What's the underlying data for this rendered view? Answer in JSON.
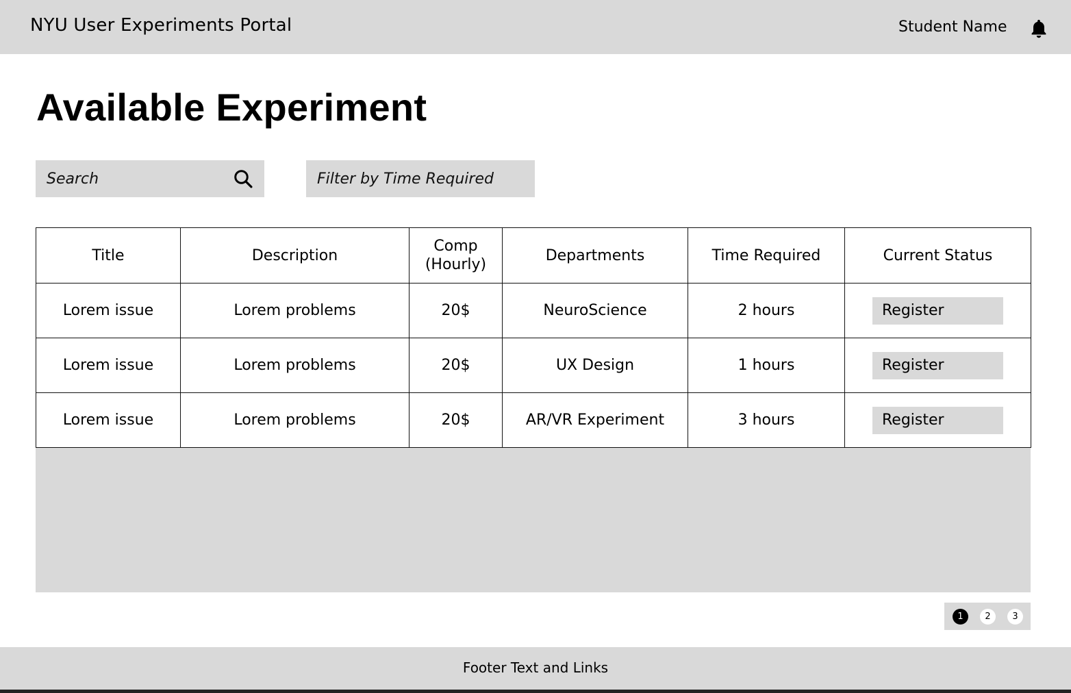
{
  "header": {
    "app_title": "NYU User Experiments Portal",
    "user_name": "Student Name",
    "notification_icon": "bell-icon"
  },
  "main": {
    "page_title": "Available Experiment",
    "search": {
      "placeholder": "Search",
      "icon": "search-icon"
    },
    "filter": {
      "placeholder": "Filter by Time Required"
    },
    "table": {
      "columns": [
        "Title",
        "Description",
        "Comp (Hourly)",
        "Departments",
        "Time Required",
        "Current Status"
      ],
      "rows": [
        {
          "title": "Lorem issue",
          "description": "Lorem problems",
          "comp": "20$",
          "department": "NeuroScience",
          "time": "2 hours",
          "status_action": "Register"
        },
        {
          "title": "Lorem issue",
          "description": "Lorem problems",
          "comp": "20$",
          "department": "UX Design",
          "time": "1 hours",
          "status_action": "Register"
        },
        {
          "title": "Lorem issue",
          "description": "Lorem problems",
          "comp": "20$",
          "department": "AR/VR Experiment",
          "time": "3 hours",
          "status_action": "Register"
        }
      ]
    },
    "pagination": {
      "pages": [
        "1",
        "2",
        "3"
      ],
      "current": "1"
    }
  },
  "footer": {
    "text": "Footer Text and Links"
  },
  "colors": {
    "panel_gray": "#d9d9d9",
    "text": "#000000",
    "background": "#ffffff"
  }
}
